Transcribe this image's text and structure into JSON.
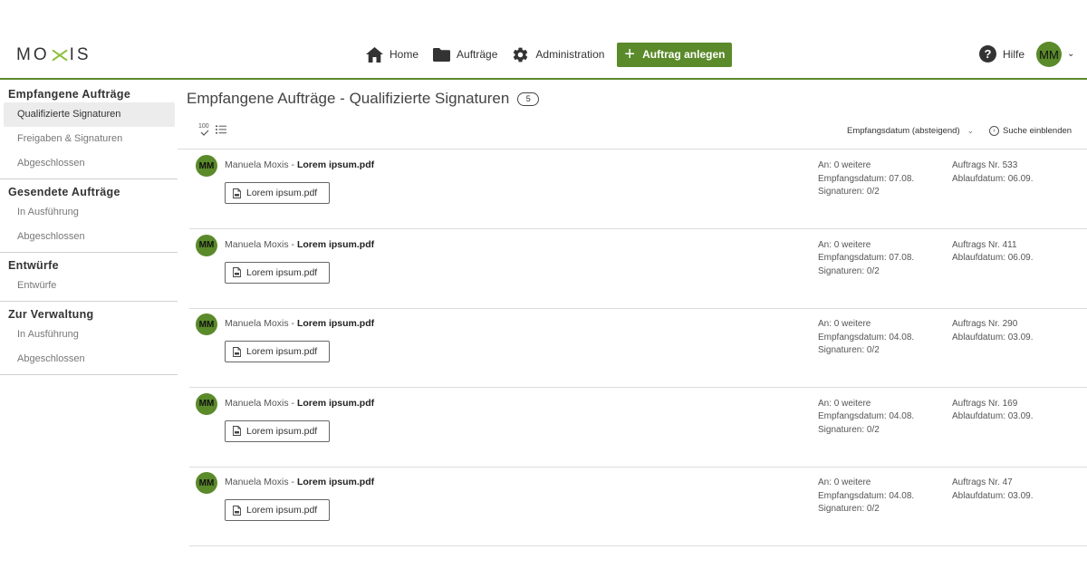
{
  "header": {
    "logo": {
      "left": "MO",
      "right": "IS"
    },
    "nav": [
      {
        "label": "Home",
        "icon": "home-icon"
      },
      {
        "label": "Aufträge",
        "icon": "folder-icon"
      },
      {
        "label": "Administration",
        "icon": "gear-icon"
      }
    ],
    "create_button": "Auftrag anlegen",
    "help_label": "Hilfe",
    "user_initials": "MM",
    "accent_color": "#5a8a2a"
  },
  "sidebar": {
    "groups": [
      {
        "title": "Empfangene Aufträge",
        "items": [
          "Qualifizierte Signaturen",
          "Freigaben & Signaturen",
          "Abgeschlossen"
        ]
      },
      {
        "title": "Gesendete Aufträge",
        "items": [
          "In Ausführung",
          "Abgeschlossen"
        ]
      },
      {
        "title": "Entwürfe",
        "items": [
          "Entwürfe"
        ]
      },
      {
        "title": "Zur Verwaltung",
        "items": [
          "In Ausführung",
          "Abgeschlossen"
        ]
      }
    ]
  },
  "main": {
    "title": "Empfangene Aufträge - Qualifizierte Signaturen",
    "count": "5",
    "view_toggle_label": "100",
    "sort_label": "Empfangsdatum (absteigend)",
    "search_toggle": "Suche einblenden",
    "rows": [
      {
        "initials": "MM",
        "sender": "Manuela Moxis - ",
        "file": "Lorem ipsum.pdf",
        "doc": "Lorem ipsum.pdf",
        "an": "An: 0 weitere",
        "empfang": "Empfangsdatum: 07.08.",
        "signaturen": "Signaturen: 0/2",
        "nr": "Auftrags Nr. 533",
        "ablauf": "Ablaufdatum: 06.09."
      },
      {
        "initials": "MM",
        "sender": "Manuela Moxis - ",
        "file": "Lorem ipsum.pdf",
        "doc": "Lorem ipsum.pdf",
        "an": "An: 0 weitere",
        "empfang": "Empfangsdatum: 07.08.",
        "signaturen": "Signaturen: 0/2",
        "nr": "Auftrags Nr. 411",
        "ablauf": "Ablaufdatum: 06.09."
      },
      {
        "initials": "MM",
        "sender": "Manuela Moxis - ",
        "file": "Lorem ipsum.pdf",
        "doc": "Lorem ipsum.pdf",
        "an": "An: 0 weitere",
        "empfang": "Empfangsdatum: 04.08.",
        "signaturen": "Signaturen: 0/2",
        "nr": "Auftrags Nr. 290",
        "ablauf": "Ablaufdatum: 03.09."
      },
      {
        "initials": "MM",
        "sender": "Manuela Moxis - ",
        "file": "Lorem ipsum.pdf",
        "doc": "Lorem ipsum.pdf",
        "an": "An: 0 weitere",
        "empfang": "Empfangsdatum: 04.08.",
        "signaturen": "Signaturen: 0/2",
        "nr": "Auftrags Nr. 169",
        "ablauf": "Ablaufdatum: 03.09."
      },
      {
        "initials": "MM",
        "sender": "Manuela Moxis - ",
        "file": "Lorem ipsum.pdf",
        "doc": "Lorem ipsum.pdf",
        "an": "An: 0 weitere",
        "empfang": "Empfangsdatum: 04.08.",
        "signaturen": "Signaturen: 0/2",
        "nr": "Auftrags Nr. 47",
        "ablauf": "Ablaufdatum: 03.09."
      }
    ]
  }
}
